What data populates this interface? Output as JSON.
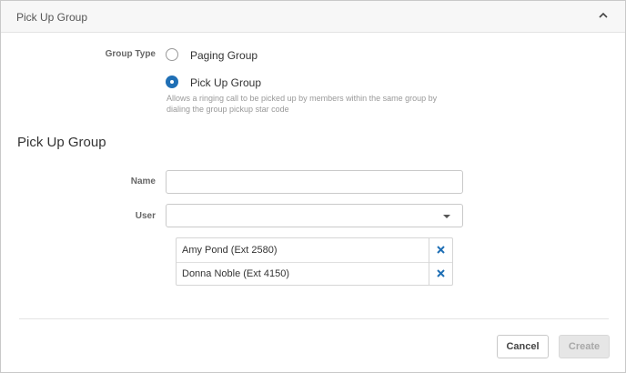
{
  "header": {
    "title": "Pick Up Group",
    "collapse_icon": "chevron-up-icon"
  },
  "group_type": {
    "label": "Group Type",
    "options": [
      {
        "label": "Paging Group",
        "selected": false
      },
      {
        "label": "Pick Up Group",
        "selected": true
      }
    ],
    "help_text": "Allows a ringing call to be picked up by members within the same group by dialing the group pickup star code"
  },
  "section": {
    "title": "Pick Up Group"
  },
  "form": {
    "name_label": "Name",
    "name_value": "",
    "user_label": "User",
    "user_value": "",
    "dropdown_icon": "caret-down-icon"
  },
  "users": [
    {
      "name": "Amy Pond (Ext 2580)",
      "remove_icon": "close-icon"
    },
    {
      "name": "Donna Noble (Ext 4150)",
      "remove_icon": "close-icon"
    }
  ],
  "footer": {
    "cancel_label": "Cancel",
    "create_label": "Create"
  },
  "colors": {
    "accent": "#1f6fb5",
    "remove_icon": "#1f6fb5",
    "disabled_button_bg": "#e6e6e6"
  }
}
